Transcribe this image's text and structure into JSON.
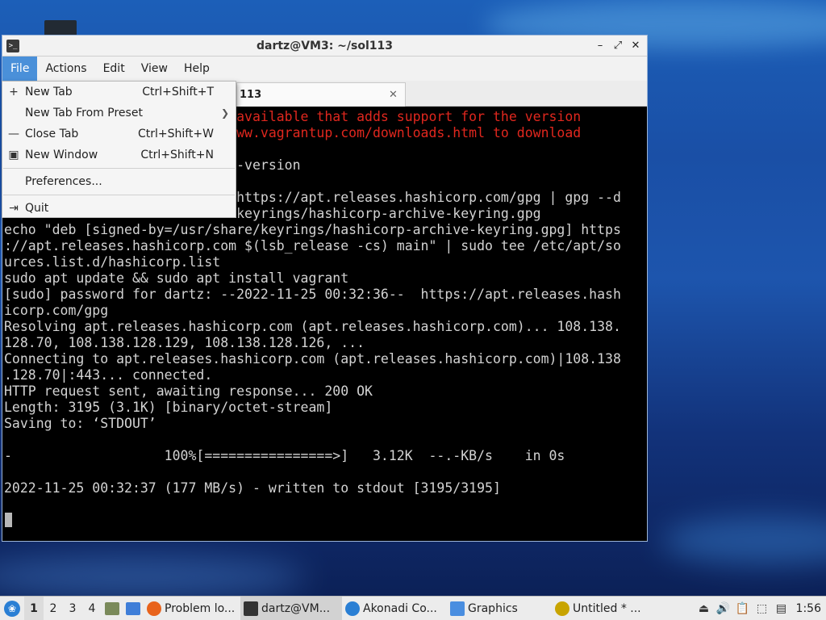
{
  "window": {
    "title": "dartz@VM3: ~/sol113",
    "app_icon_glyph": ">_",
    "controls": {
      "minimize": "–",
      "maximize": "⤢",
      "close": "✕"
    }
  },
  "menubar": {
    "file": "File",
    "actions": "Actions",
    "edit": "Edit",
    "view": "View",
    "help": "Help"
  },
  "tab": {
    "label": "113",
    "close_glyph": "✕"
  },
  "file_menu": {
    "new_tab": {
      "label": "New Tab",
      "shortcut": "Ctrl+Shift+T",
      "icon": "plus-icon"
    },
    "new_tab_from_preset": {
      "label": "New Tab From Preset",
      "icon": "submenu-arrow-icon"
    },
    "close_tab": {
      "label": "Close Tab",
      "shortcut": "Ctrl+Shift+W",
      "icon": "minus-icon"
    },
    "new_window": {
      "label": "New Window",
      "shortcut": "Ctrl+Shift+N",
      "icon": "window-icon"
    },
    "preferences": {
      "label": "Preferences..."
    },
    "quit": {
      "label": "Quit",
      "icon": "exit-icon"
    }
  },
  "terminal": {
    "lines": [
      {
        "text": "                             available that adds support for the version",
        "red": true
      },
      {
        "text": "                             ww.vagrantup.com/downloads.html to download",
        "red": true
      },
      {
        "text": "",
        "red": false
      },
      {
        "text": "                             -version",
        "red": false
      },
      {
        "text": "",
        "red": false
      },
      {
        "text": "                             https://apt.releases.hashicorp.com/gpg | gpg --d",
        "red": false
      },
      {
        "text": "                             keyrings/hashicorp-archive-keyring.gpg",
        "red": false
      },
      {
        "text": "echo \"deb [signed-by=/usr/share/keyrings/hashicorp-archive-keyring.gpg] https",
        "red": false
      },
      {
        "text": "://apt.releases.hashicorp.com $(lsb_release -cs) main\" | sudo tee /etc/apt/so",
        "red": false
      },
      {
        "text": "urces.list.d/hashicorp.list",
        "red": false
      },
      {
        "text": "sudo apt update && sudo apt install vagrant",
        "red": false
      },
      {
        "text": "[sudo] password for dartz: --2022-11-25 00:32:36--  https://apt.releases.hash",
        "red": false
      },
      {
        "text": "icorp.com/gpg",
        "red": false
      },
      {
        "text": "Resolving apt.releases.hashicorp.com (apt.releases.hashicorp.com)... 108.138.",
        "red": false
      },
      {
        "text": "128.70, 108.138.128.129, 108.138.128.126, ...",
        "red": false
      },
      {
        "text": "Connecting to apt.releases.hashicorp.com (apt.releases.hashicorp.com)|108.138",
        "red": false
      },
      {
        "text": ".128.70|:443... connected.",
        "red": false
      },
      {
        "text": "HTTP request sent, awaiting response... 200 OK",
        "red": false
      },
      {
        "text": "Length: 3195 (3.1K) [binary/octet-stream]",
        "red": false
      },
      {
        "text": "Saving to: ‘STDOUT’",
        "red": false
      },
      {
        "text": "",
        "red": false
      },
      {
        "text": "-                   100%[================>]   3.12K  --.-KB/s    in 0s",
        "red": false
      },
      {
        "text": "",
        "red": false
      },
      {
        "text": "2022-11-25 00:32:37 (177 MB/s) - written to stdout [3195/3195]",
        "red": false
      }
    ]
  },
  "taskbar": {
    "workspaces": [
      "1",
      "2",
      "3",
      "4"
    ],
    "tasks": [
      {
        "label": "Problem lo...",
        "icon": "firefox-icon",
        "color": "#e8631c"
      },
      {
        "label": "dartz@VM...",
        "icon": "terminal-icon",
        "color": "#333333"
      },
      {
        "label": "Akonadi Co...",
        "icon": "akonadi-icon",
        "color": "#2a7fd4"
      },
      {
        "label": "Graphics",
        "icon": "folder-icon",
        "color": "#4a8ee0"
      },
      {
        "label": "Untitled * ...",
        "icon": "record-icon",
        "color": "#c8a400"
      }
    ],
    "clock": "1:56"
  },
  "colors": {
    "menu_highlight": "#4a90d9",
    "terminal_bg": "#000000",
    "terminal_fg": "#d3d3d3",
    "terminal_red": "#e0271e"
  }
}
